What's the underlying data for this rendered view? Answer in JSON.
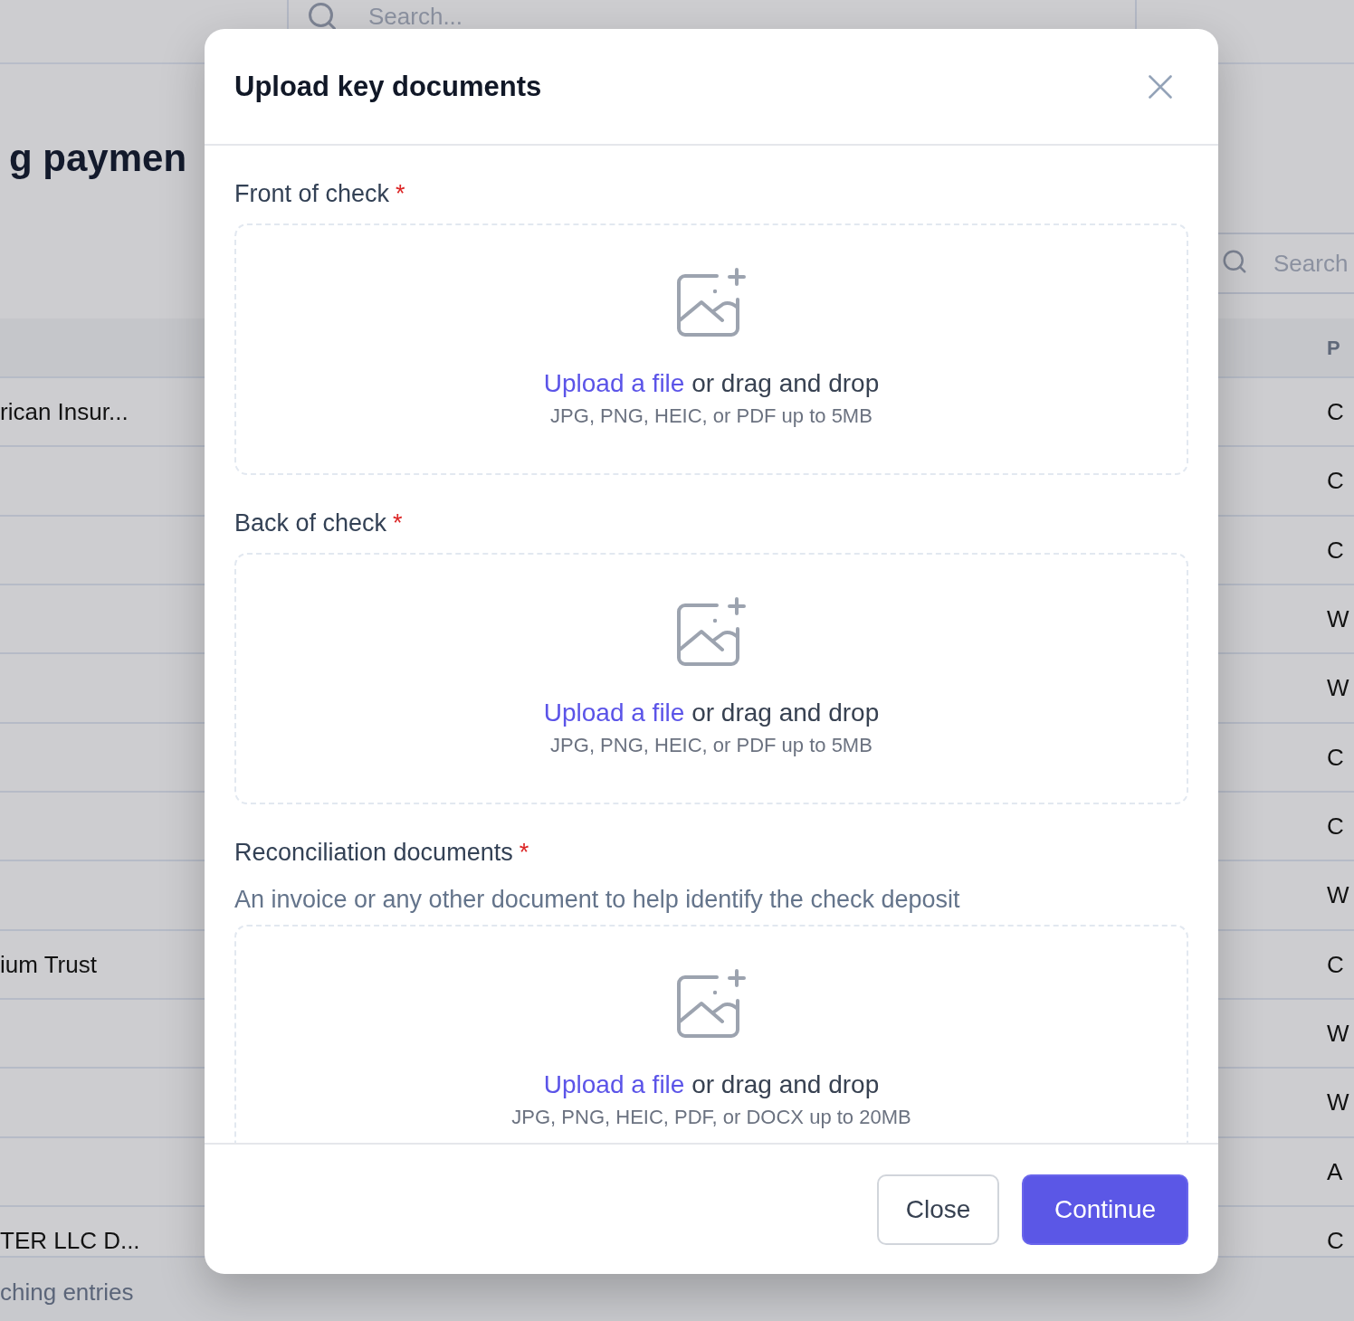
{
  "page": {
    "search": {
      "placeholder": "Search..."
    },
    "title": "g paymen",
    "table_search": {
      "placeholder": "Search"
    },
    "table": {
      "header": {
        "column_2": "P"
      },
      "rows": [
        {
          "column_1": "rican Insur...",
          "column_2": "C"
        },
        {
          "column_2": "C"
        },
        {
          "column_2": "C"
        },
        {
          "column_2": "W"
        },
        {
          "column_2": "W"
        },
        {
          "column_2": "C"
        },
        {
          "column_2": "C"
        },
        {
          "column_2": "W"
        },
        {
          "column_1": "ium Trust",
          "column_2": "C"
        },
        {
          "column_2": "W"
        },
        {
          "column_2": "W"
        },
        {
          "column_2": "A"
        },
        {
          "column_1": "TER LLC D...",
          "column_2": "C"
        }
      ]
    },
    "footer": "ching entries"
  },
  "dialog": {
    "title": "Upload key documents",
    "fields": [
      {
        "label": "Front of check",
        "required_mark": "*",
        "dropzone": {
          "link": "Upload a file",
          "text": "or drag and drop",
          "hint": "JPG, PNG, HEIC, or PDF up to 5MB"
        }
      },
      {
        "label": "Back of check",
        "required_mark": "*",
        "dropzone": {
          "link": "Upload a file",
          "text": "or drag and drop",
          "hint": "JPG, PNG, HEIC, or PDF up to 5MB"
        }
      },
      {
        "label": "Reconciliation documents",
        "required_mark": "*",
        "description": "An invoice or any other document to help identify the check deposit",
        "dropzone": {
          "link": "Upload a file",
          "text": "or drag and drop",
          "hint": "JPG, PNG, HEIC, PDF, or DOCX up to 20MB"
        }
      }
    ],
    "buttons": [
      {
        "label": "Close",
        "kind": "secondary"
      },
      {
        "label": "Continue",
        "kind": "primary"
      }
    ]
  }
}
